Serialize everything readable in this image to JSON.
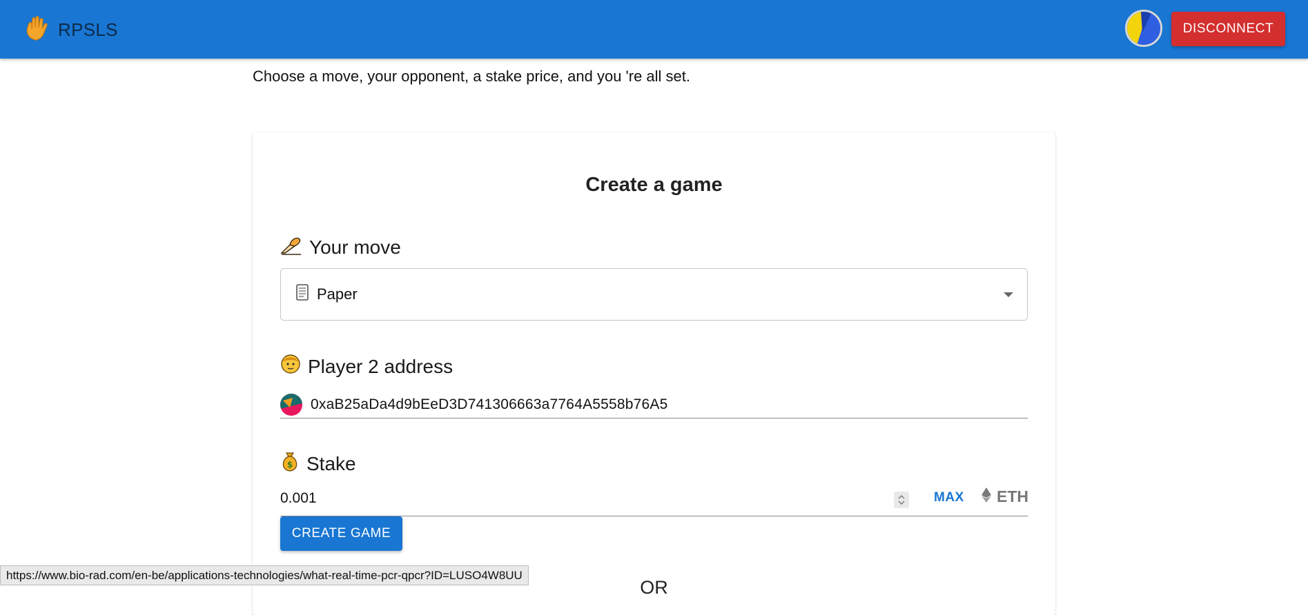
{
  "appbar": {
    "brand": "RPSLS",
    "brand_icon": "hand-icon",
    "disconnect_label": "DISCONNECT",
    "accent_color": "#1976d2",
    "disconnect_color": "#d32f2f"
  },
  "intro_text": "Choose a move, your opponent, a stake price, and you 're all set.",
  "card": {
    "title": "Create a game",
    "move": {
      "label": "Your move",
      "icon": "writing-hand-icon",
      "selected": "Paper",
      "selected_icon": "scroll-icon"
    },
    "player2": {
      "label": "Player 2 address",
      "icon": "face-icon",
      "address": "0xaB25aDa4d9bEeD3D741306663a7764A5558b76A5"
    },
    "stake": {
      "label": "Stake",
      "icon": "money-bag-icon",
      "value": "0.001",
      "max_label": "MAX",
      "currency": "ETH",
      "currency_icon": "ethereum-icon"
    },
    "create_label": "CREATE GAME",
    "or_text": "OR"
  },
  "status_url": "https://www.bio-rad.com/en-be/applications-technologies/what-real-time-pcr-qpcr?ID=LUSO4W8UU"
}
